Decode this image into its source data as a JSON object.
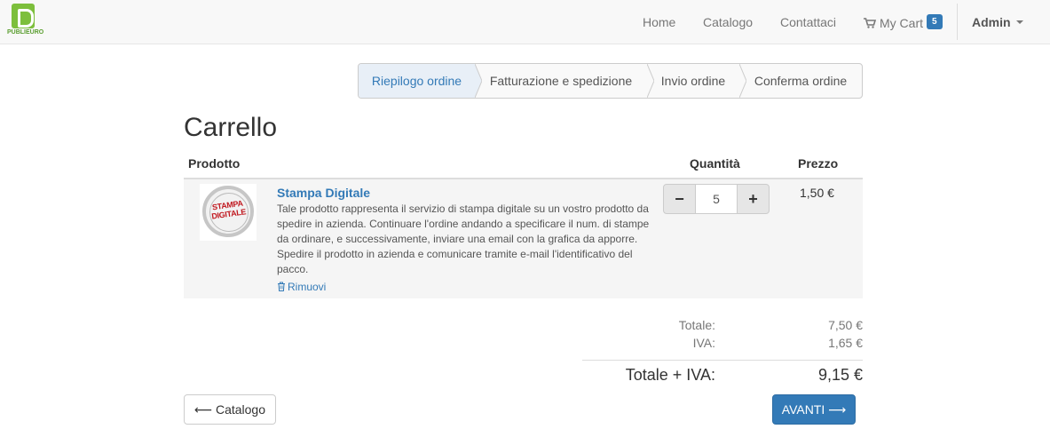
{
  "brand": {
    "logo_text": "PUBLIEURO",
    "accent": "#7dbf3c"
  },
  "navbar": {
    "home": "Home",
    "catalogo": "Catalogo",
    "contattaci": "Contattaci",
    "cart_label": "My Cart",
    "cart_count": "5",
    "admin": "Admin"
  },
  "steps": [
    {
      "label": "Riepilogo ordine",
      "active": true
    },
    {
      "label": "Fatturazione e spedizione",
      "active": false
    },
    {
      "label": "Invio ordine",
      "active": false
    },
    {
      "label": "Conferma ordine",
      "active": false
    }
  ],
  "page_title": "Carrello",
  "table": {
    "headers": {
      "product": "Prodotto",
      "quantity": "Quantità",
      "price": "Prezzo"
    },
    "items": [
      {
        "thumb_text": "STAMPA DIGITALE",
        "title": "Stampa Digitale",
        "description": "Tale prodotto rappresenta il servizio di stampa digitale su un vostro prodotto da spedire in azienda. Continuare l'ordine andando a specificare il num. di stampe da ordinare, e successivamente, inviare una email con la grafica da apporre. Spedire il prodotto in azienda e comunicare tramite e-mail l'identificativo del pacco.",
        "remove_label": "Rimuovi",
        "quantity": "5",
        "minus": "−",
        "plus": "+",
        "price": "1,50 €"
      }
    ]
  },
  "totals": {
    "subtotal_label": "Totale:",
    "subtotal_value": "7,50 €",
    "iva_label": "IVA:",
    "iva_value": "1,65 €",
    "grand_label": "Totale + IVA:",
    "grand_value": "9,15 €"
  },
  "buttons": {
    "back_label": "Catalogo",
    "next_label": "AVANTI"
  },
  "colors": {
    "primary": "#337ab7",
    "active_step_bg": "#e8eff7"
  }
}
